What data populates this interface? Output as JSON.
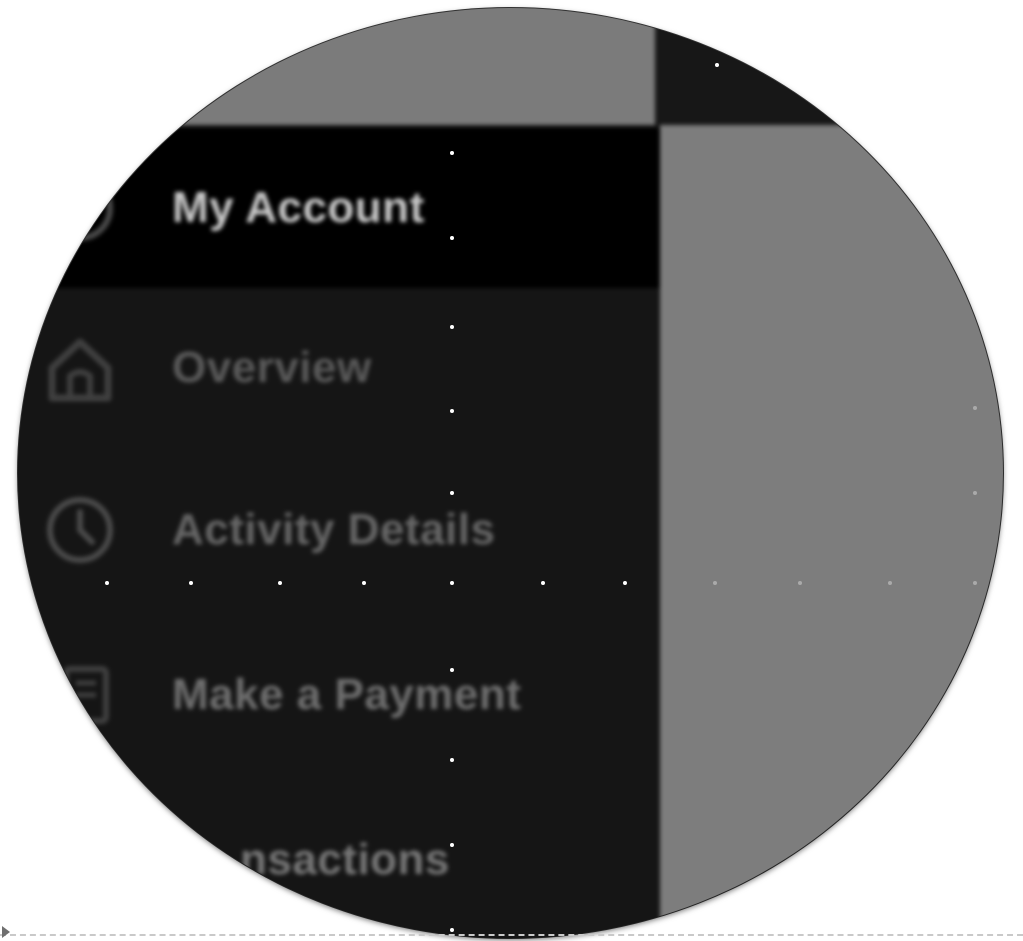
{
  "menu": {
    "items": [
      {
        "label": "My Account",
        "icon": "user-circle-icon",
        "active": true
      },
      {
        "label": "Overview",
        "icon": "home-icon",
        "active": false
      },
      {
        "label": "Activity Details",
        "icon": "clock-icon",
        "active": false
      },
      {
        "label": "Make a Payment",
        "icon": "payment-icon",
        "active": false
      },
      {
        "label": "nsactions",
        "icon": "",
        "active": false
      }
    ]
  },
  "colors": {
    "sidebar_bg": "#151515",
    "active_bg": "#000000",
    "content_gray": "#7d7d7d",
    "label_active": "#c8c8c8",
    "label_inactive": "#8a8a8a"
  }
}
